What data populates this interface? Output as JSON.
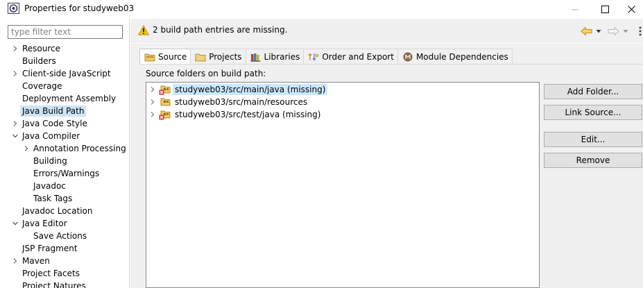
{
  "window": {
    "title": "Properties for studyweb03",
    "icons": [
      "app-icon",
      "minimize-icon",
      "maximize-icon",
      "close-icon"
    ]
  },
  "filter": {
    "placeholder": "type filter text",
    "value": ""
  },
  "nav_tree": [
    {
      "label": "Resource",
      "level": 0,
      "expander": "collapsed"
    },
    {
      "label": "Builders",
      "level": 0,
      "expander": "none"
    },
    {
      "label": "Client-side JavaScript",
      "level": 0,
      "expander": "collapsed"
    },
    {
      "label": "Coverage",
      "level": 0,
      "expander": "none"
    },
    {
      "label": "Deployment Assembly",
      "level": 0,
      "expander": "none"
    },
    {
      "label": "Java Build Path",
      "level": 0,
      "expander": "none",
      "selected": true
    },
    {
      "label": "Java Code Style",
      "level": 0,
      "expander": "collapsed"
    },
    {
      "label": "Java Compiler",
      "level": 0,
      "expander": "expanded"
    },
    {
      "label": "Annotation Processing",
      "level": 1,
      "expander": "collapsed"
    },
    {
      "label": "Building",
      "level": 1,
      "expander": "none"
    },
    {
      "label": "Errors/Warnings",
      "level": 1,
      "expander": "none"
    },
    {
      "label": "Javadoc",
      "level": 1,
      "expander": "none"
    },
    {
      "label": "Task Tags",
      "level": 1,
      "expander": "none"
    },
    {
      "label": "Javadoc Location",
      "level": 0,
      "expander": "none"
    },
    {
      "label": "Java Editor",
      "level": 0,
      "expander": "expanded"
    },
    {
      "label": "Save Actions",
      "level": 1,
      "expander": "none"
    },
    {
      "label": "JSP Fragment",
      "level": 0,
      "expander": "none"
    },
    {
      "label": "Maven",
      "level": 0,
      "expander": "collapsed"
    },
    {
      "label": "Project Facets",
      "level": 0,
      "expander": "none"
    },
    {
      "label": "Project Natures",
      "level": 0,
      "expander": "none"
    }
  ],
  "message": {
    "icon": "warning-icon",
    "text": "2 build path entries are missing."
  },
  "header_nav_icons": [
    "back-arrow-icon",
    "back-dropdown-icon",
    "forward-arrow-icon",
    "forward-dropdown-icon",
    "view-menu-icon"
  ],
  "tabs": [
    {
      "label": "Source",
      "icon": "source-folder-icon",
      "active": true
    },
    {
      "label": "Projects",
      "icon": "projects-icon",
      "active": false
    },
    {
      "label": "Libraries",
      "icon": "libraries-icon",
      "active": false
    },
    {
      "label": "Order and Export",
      "icon": "order-export-icon",
      "active": false
    },
    {
      "label": "Module Dependencies",
      "icon": "module-icon",
      "active": false
    }
  ],
  "source_label": "Source folders on build path:",
  "source_folders": [
    {
      "path": "studyweb03/src/main/java (missing)",
      "missing": true,
      "selected": true
    },
    {
      "path": "studyweb03/src/main/resources",
      "missing": false,
      "selected": false
    },
    {
      "path": "studyweb03/src/test/java (missing)",
      "missing": true,
      "selected": false
    }
  ],
  "buttons": {
    "add_folder": "Add Folder...",
    "link_source": "Link Source...",
    "edit": "Edit...",
    "remove": "Remove"
  },
  "colors": {
    "selection": "#cce4f7",
    "list_selection": "#cce8ff",
    "warning": "#f0c419",
    "folder": "#e8b84a",
    "error_mark": "#d9302c",
    "nav_arrow": "#e8a317"
  }
}
